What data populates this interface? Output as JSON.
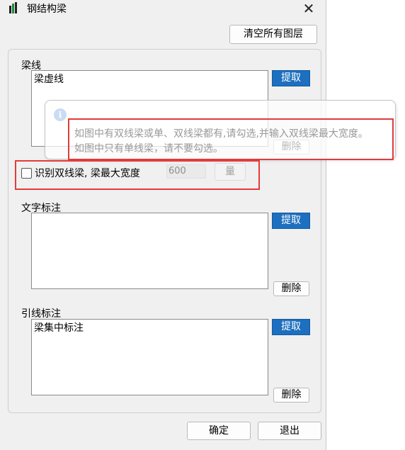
{
  "window": {
    "title": "钢结构梁",
    "close_symbol": "✕"
  },
  "toolbar": {
    "clear_layers": "清空所有图层"
  },
  "beam_lines": {
    "label": "梁线",
    "items": [
      "梁虚线"
    ],
    "pick": "提取",
    "delete": "删除"
  },
  "double_beam": {
    "checkbox_label": "识别双线梁, 梁最大宽度",
    "width_value": "600",
    "measure_button": "量"
  },
  "text_annotation": {
    "label": "文字标注",
    "items": [],
    "pick": "提取",
    "delete": "删除"
  },
  "leader_annotation": {
    "label": "引线标注",
    "items": [
      "梁集中标注"
    ],
    "pick": "提取",
    "delete": "删除"
  },
  "footer": {
    "ok": "确定",
    "cancel": "退出"
  },
  "tooltip": {
    "icon": "i",
    "line1": "如图中有双线梁或单、双线梁都有,请勾选,并输入双线梁最大宽度。",
    "line2": "如图中只有单线梁，请不要勾选。"
  },
  "colors": {
    "accent": "#1d6fbf",
    "highlight": "#e23b3b"
  }
}
